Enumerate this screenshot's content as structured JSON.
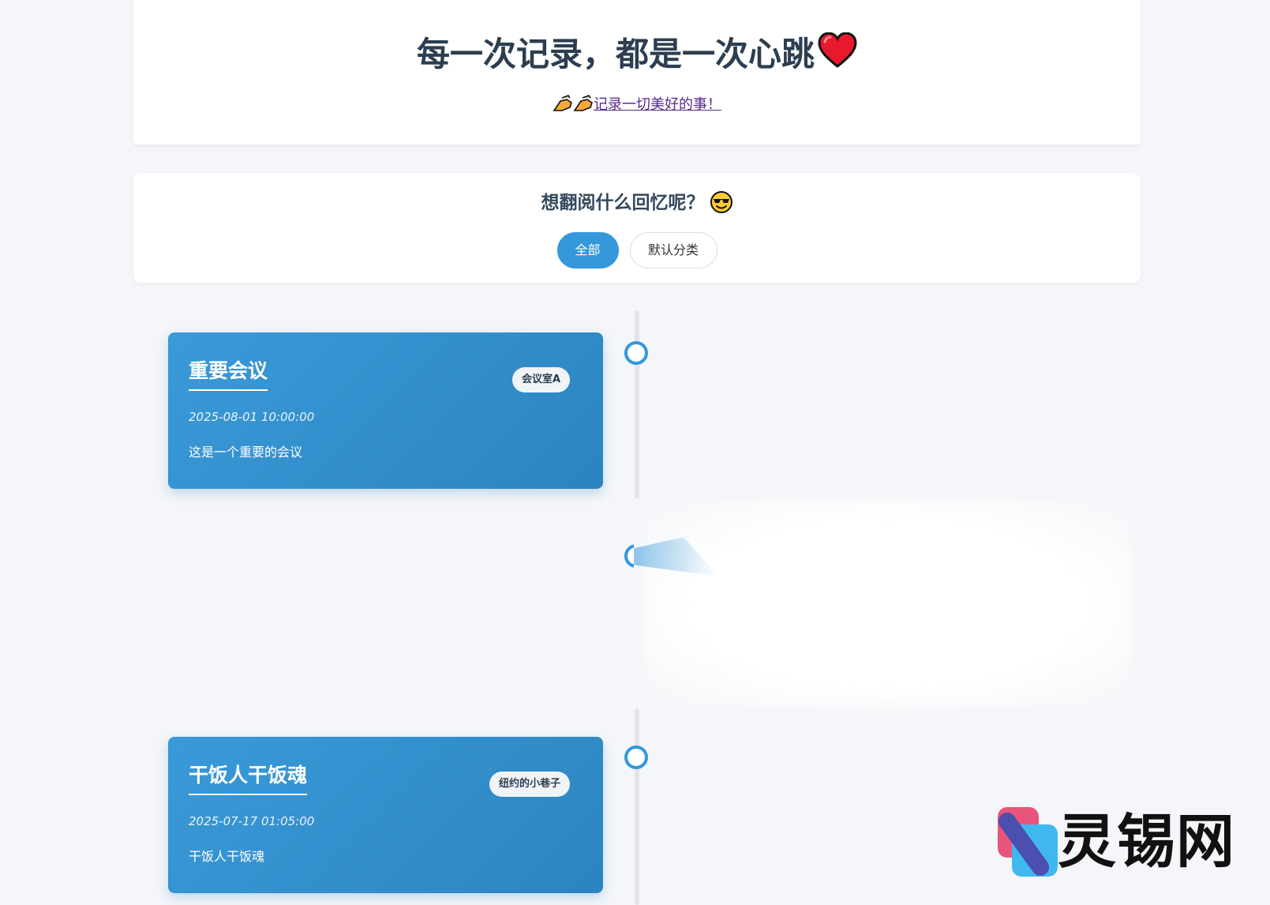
{
  "header": {
    "title": "每一次记录，都是一次心跳",
    "title_icon": "heart-icon",
    "subtitle_icons": [
      "writing-hand-icon",
      "writing-hand-icon"
    ],
    "subtitle_link": "记录一切美好的事！"
  },
  "filter": {
    "title": "想翻阅什么回忆呢？",
    "title_icon": "sunglasses-smile-icon",
    "buttons": [
      {
        "label": "全部",
        "active": true
      },
      {
        "label": "默认分类",
        "active": false
      }
    ]
  },
  "timeline": {
    "items": [
      {
        "title": "重要会议",
        "location": "会议室A",
        "date": "2025-08-01 10:00:00",
        "description": "这是一个重要的会议",
        "side": "left"
      },
      {
        "title": "干饭人干饭魂",
        "location": "纽约的小巷子",
        "date": "2025-07-17 01:05:00",
        "description": "干饭人干饭魂",
        "side": "left"
      }
    ]
  },
  "watermark": {
    "text": "灵锡网"
  },
  "colors": {
    "accent": "#3498db",
    "card_start": "#3a9ad9",
    "card_end": "#2c84bf",
    "background": "#f4f6f9",
    "title": "#2c3e50"
  }
}
